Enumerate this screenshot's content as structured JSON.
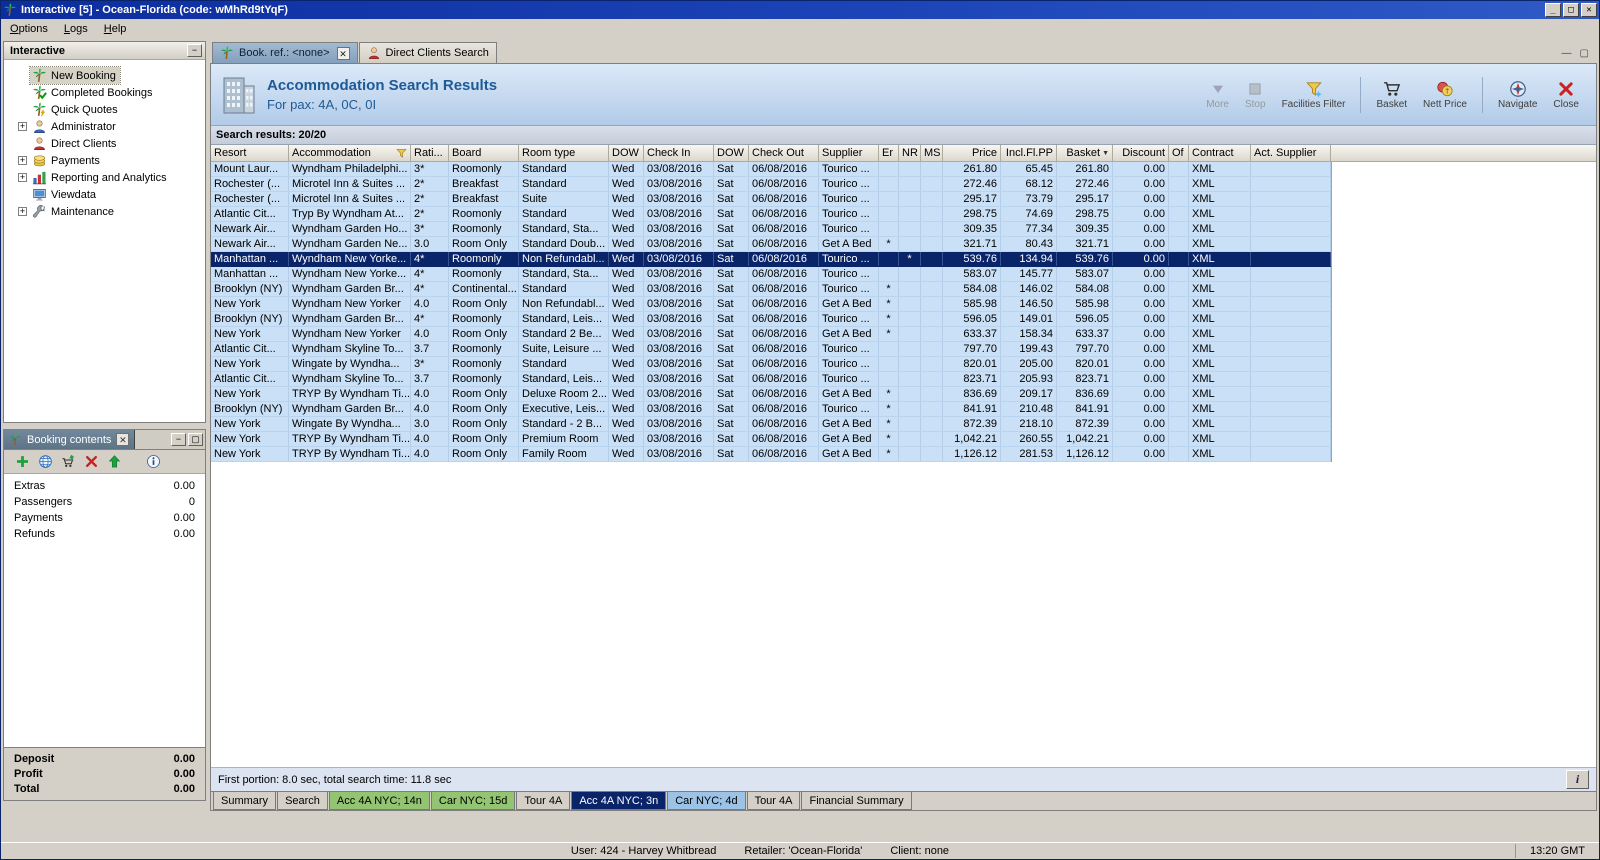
{
  "window": {
    "title": "Interactive [5] - Ocean-Florida (code: wMhRd9tYqF)",
    "icon": "palm-tree",
    "buttons": [
      "minimize",
      "maximize",
      "close"
    ],
    "menu": [
      "Options",
      "Logs",
      "Help"
    ]
  },
  "sidebar": {
    "title": "Interactive",
    "items": [
      {
        "label": "New Booking",
        "icon": "palm-tree",
        "selected": true
      },
      {
        "label": "Completed Bookings",
        "icon": "palm-check"
      },
      {
        "label": "Quick Quotes",
        "icon": "palm-quick"
      },
      {
        "label": "Administrator",
        "icon": "user-admin",
        "expandable": true
      },
      {
        "label": "Direct Clients",
        "icon": "user-red"
      },
      {
        "label": "Payments",
        "icon": "coins",
        "expandable": true
      },
      {
        "label": "Reporting and Analytics",
        "icon": "chart-bars",
        "expandable": true
      },
      {
        "label": "Viewdata",
        "icon": "monitor"
      },
      {
        "label": "Maintenance",
        "icon": "wrench",
        "expandable": true
      }
    ]
  },
  "booking_contents": {
    "title": "Booking contents",
    "toolbar": [
      "add-item",
      "world",
      "add-to-basket",
      "remove-item",
      "move-up",
      "info"
    ],
    "items": [
      {
        "label": "Extras",
        "value": "0.00"
      },
      {
        "label": "Passengers",
        "value": "0"
      },
      {
        "label": "Payments",
        "value": "0.00"
      },
      {
        "label": "Refunds",
        "value": "0.00"
      }
    ],
    "totals": [
      {
        "label": "Deposit",
        "value": "0.00"
      },
      {
        "label": "Profit",
        "value": "0.00"
      },
      {
        "label": "Total",
        "value": "0.00"
      }
    ]
  },
  "document_tabs": [
    {
      "label": "Book. ref.: <none>",
      "icon": "palm-tree",
      "active": true,
      "closable": true
    },
    {
      "label": "Direct Clients Search",
      "icon": "user-red"
    }
  ],
  "header": {
    "icon": "building",
    "title": "Accommodation Search Results",
    "subtitle": "For pax: 4A, 0C, 0I",
    "toolbar": [
      {
        "label": "More",
        "icon": "more-arrow",
        "disabled": true
      },
      {
        "label": "Stop",
        "icon": "stop",
        "disabled": true
      },
      {
        "label": "Facilities Filter",
        "icon": "facilities-filter"
      },
      {
        "separator": true
      },
      {
        "label": "Basket",
        "icon": "basket-cart"
      },
      {
        "label": "Nett Price",
        "icon": "nett-price"
      },
      {
        "separator": true
      },
      {
        "label": "Navigate",
        "icon": "navigate-compass"
      },
      {
        "label": "Close",
        "icon": "close-red"
      }
    ]
  },
  "results": {
    "label": "Search results: 20/20",
    "footer": "First portion: 8.0 sec, total search time: 11.8 sec",
    "selected_row": 6,
    "columns": [
      {
        "label": "Resort"
      },
      {
        "label": "Accommodation",
        "filter": true
      },
      {
        "label": "Rati..."
      },
      {
        "label": "Board"
      },
      {
        "label": "Room type"
      },
      {
        "label": "DOW"
      },
      {
        "label": "Check In"
      },
      {
        "label": "DOW"
      },
      {
        "label": "Check Out"
      },
      {
        "label": "Supplier"
      },
      {
        "label": "Er"
      },
      {
        "label": "NR"
      },
      {
        "label": "MS"
      },
      {
        "label": "Price",
        "align": "right"
      },
      {
        "label": "Incl.Fl.PP",
        "align": "right"
      },
      {
        "label": "Basket",
        "align": "right",
        "sort": "desc"
      },
      {
        "label": "Discount",
        "align": "right"
      },
      {
        "label": "Of"
      },
      {
        "label": "Contract"
      },
      {
        "label": "Act. Supplier"
      }
    ],
    "rows": [
      [
        "Mount Laur...",
        "Wyndham Philadelphi...",
        "3*",
        "Roomonly",
        "Standard",
        "Wed",
        "03/08/2016",
        "Sat",
        "06/08/2016",
        "Tourico ...",
        "",
        "",
        "",
        "261.80",
        "65.45",
        "261.80",
        "0.00",
        "",
        "XML",
        ""
      ],
      [
        "Rochester (...",
        "Microtel Inn & Suites ...",
        "2*",
        "Breakfast",
        "Standard",
        "Wed",
        "03/08/2016",
        "Sat",
        "06/08/2016",
        "Tourico ...",
        "",
        "",
        "",
        "272.46",
        "68.12",
        "272.46",
        "0.00",
        "",
        "XML",
        ""
      ],
      [
        "Rochester (...",
        "Microtel Inn & Suites ...",
        "2*",
        "Breakfast",
        "Suite",
        "Wed",
        "03/08/2016",
        "Sat",
        "06/08/2016",
        "Tourico ...",
        "",
        "",
        "",
        "295.17",
        "73.79",
        "295.17",
        "0.00",
        "",
        "XML",
        ""
      ],
      [
        "Atlantic Cit...",
        "Tryp By Wyndham At...",
        "2*",
        "Roomonly",
        "Standard",
        "Wed",
        "03/08/2016",
        "Sat",
        "06/08/2016",
        "Tourico ...",
        "",
        "",
        "",
        "298.75",
        "74.69",
        "298.75",
        "0.00",
        "",
        "XML",
        ""
      ],
      [
        "Newark Air...",
        "Wyndham Garden Ho...",
        "3*",
        "Roomonly",
        "Standard, Sta...",
        "Wed",
        "03/08/2016",
        "Sat",
        "06/08/2016",
        "Tourico ...",
        "",
        "",
        "",
        "309.35",
        "77.34",
        "309.35",
        "0.00",
        "",
        "XML",
        ""
      ],
      [
        "Newark Air...",
        "Wyndham Garden Ne...",
        "3.0",
        "Room Only",
        "Standard Doub...",
        "Wed",
        "03/08/2016",
        "Sat",
        "06/08/2016",
        "Get A Bed",
        "*",
        "",
        "",
        "321.71",
        "80.43",
        "321.71",
        "0.00",
        "",
        "XML",
        ""
      ],
      [
        "Manhattan ...",
        "Wyndham New Yorke...",
        "4*",
        "Roomonly",
        "Non Refundabl...",
        "Wed",
        "03/08/2016",
        "Sat",
        "06/08/2016",
        "Tourico ...",
        "",
        "*",
        "",
        "539.76",
        "134.94",
        "539.76",
        "0.00",
        "",
        "XML",
        ""
      ],
      [
        "Manhattan ...",
        "Wyndham New Yorke...",
        "4*",
        "Roomonly",
        "Standard, Sta...",
        "Wed",
        "03/08/2016",
        "Sat",
        "06/08/2016",
        "Tourico ...",
        "",
        "",
        "",
        "583.07",
        "145.77",
        "583.07",
        "0.00",
        "",
        "XML",
        ""
      ],
      [
        "Brooklyn (NY)",
        "Wyndham Garden Br...",
        "4*",
        "Continental...",
        "Standard",
        "Wed",
        "03/08/2016",
        "Sat",
        "06/08/2016",
        "Tourico ...",
        "*",
        "",
        "",
        "584.08",
        "146.02",
        "584.08",
        "0.00",
        "",
        "XML",
        ""
      ],
      [
        "New York",
        "Wyndham New Yorker",
        "4.0",
        "Room Only",
        "Non Refundabl...",
        "Wed",
        "03/08/2016",
        "Sat",
        "06/08/2016",
        "Get A Bed",
        "*",
        "",
        "",
        "585.98",
        "146.50",
        "585.98",
        "0.00",
        "",
        "XML",
        ""
      ],
      [
        "Brooklyn (NY)",
        "Wyndham Garden Br...",
        "4*",
        "Roomonly",
        "Standard, Leis...",
        "Wed",
        "03/08/2016",
        "Sat",
        "06/08/2016",
        "Tourico ...",
        "*",
        "",
        "",
        "596.05",
        "149.01",
        "596.05",
        "0.00",
        "",
        "XML",
        ""
      ],
      [
        "New York",
        "Wyndham New Yorker",
        "4.0",
        "Room Only",
        "Standard 2 Be...",
        "Wed",
        "03/08/2016",
        "Sat",
        "06/08/2016",
        "Get A Bed",
        "*",
        "",
        "",
        "633.37",
        "158.34",
        "633.37",
        "0.00",
        "",
        "XML",
        ""
      ],
      [
        "Atlantic Cit...",
        "Wyndham Skyline To...",
        "3.7",
        "Roomonly",
        "Suite, Leisure ...",
        "Wed",
        "03/08/2016",
        "Sat",
        "06/08/2016",
        "Tourico ...",
        "",
        "",
        "",
        "797.70",
        "199.43",
        "797.70",
        "0.00",
        "",
        "XML",
        ""
      ],
      [
        "New York",
        "Wingate by Wyndha...",
        "3*",
        "Roomonly",
        "Standard",
        "Wed",
        "03/08/2016",
        "Sat",
        "06/08/2016",
        "Tourico ...",
        "",
        "",
        "",
        "820.01",
        "205.00",
        "820.01",
        "0.00",
        "",
        "XML",
        ""
      ],
      [
        "Atlantic Cit...",
        "Wyndham Skyline To...",
        "3.7",
        "Roomonly",
        "Standard, Leis...",
        "Wed",
        "03/08/2016",
        "Sat",
        "06/08/2016",
        "Tourico ...",
        "",
        "",
        "",
        "823.71",
        "205.93",
        "823.71",
        "0.00",
        "",
        "XML",
        ""
      ],
      [
        "New York",
        "TRYP By Wyndham Ti...",
        "4.0",
        "Room Only",
        "Deluxe Room 2...",
        "Wed",
        "03/08/2016",
        "Sat",
        "06/08/2016",
        "Get A Bed",
        "*",
        "",
        "",
        "836.69",
        "209.17",
        "836.69",
        "0.00",
        "",
        "XML",
        ""
      ],
      [
        "Brooklyn (NY)",
        "Wyndham Garden Br...",
        "4.0",
        "Room Only",
        "Executive, Leis...",
        "Wed",
        "03/08/2016",
        "Sat",
        "06/08/2016",
        "Tourico ...",
        "*",
        "",
        "",
        "841.91",
        "210.48",
        "841.91",
        "0.00",
        "",
        "XML",
        ""
      ],
      [
        "New York",
        "Wingate By Wyndha...",
        "3.0",
        "Room Only",
        "Standard - 2 B...",
        "Wed",
        "03/08/2016",
        "Sat",
        "06/08/2016",
        "Get A Bed",
        "*",
        "",
        "",
        "872.39",
        "218.10",
        "872.39",
        "0.00",
        "",
        "XML",
        ""
      ],
      [
        "New York",
        "TRYP By Wyndham Ti...",
        "4.0",
        "Room Only",
        "Premium Room",
        "Wed",
        "03/08/2016",
        "Sat",
        "06/08/2016",
        "Get A Bed",
        "*",
        "",
        "",
        "1,042.21",
        "260.55",
        "1,042.21",
        "0.00",
        "",
        "XML",
        ""
      ],
      [
        "New York",
        "TRYP By Wyndham Ti...",
        "4.0",
        "Room Only",
        "Family Room",
        "Wed",
        "03/08/2016",
        "Sat",
        "06/08/2016",
        "Get A Bed",
        "*",
        "",
        "",
        "1,126.12",
        "281.53",
        "1,126.12",
        "0.00",
        "",
        "XML",
        ""
      ]
    ]
  },
  "bottom_tabs": [
    {
      "label": "Summary"
    },
    {
      "label": "Search"
    },
    {
      "label": "Acc 4A NYC; 14n",
      "style": "green"
    },
    {
      "label": "Car NYC; 15d",
      "style": "green"
    },
    {
      "label": "Tour 4A"
    },
    {
      "label": "Acc 4A NYC; 3n",
      "style": "selected"
    },
    {
      "label": "Car NYC; 4d",
      "style": "blue"
    },
    {
      "label": "Tour 4A"
    },
    {
      "label": "Financial Summary"
    }
  ],
  "status_bar": {
    "user": "User: 424 - Harvey Whitbread",
    "retailer": "Retailer: 'Ocean-Florida'",
    "client": "Client: none",
    "time": "13:20 GMT"
  }
}
